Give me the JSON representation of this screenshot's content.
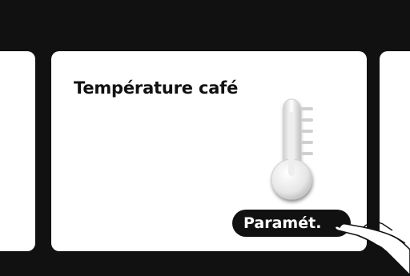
{
  "screen": {
    "title": "Température café",
    "settings_button_label": "Paramét."
  },
  "icons": {
    "main": "thermometer-icon",
    "pointer": "hand-pointer-icon"
  },
  "colors": {
    "background": "#111111",
    "panel": "#ffffff",
    "button": "#111111",
    "button_text": "#ffffff"
  }
}
